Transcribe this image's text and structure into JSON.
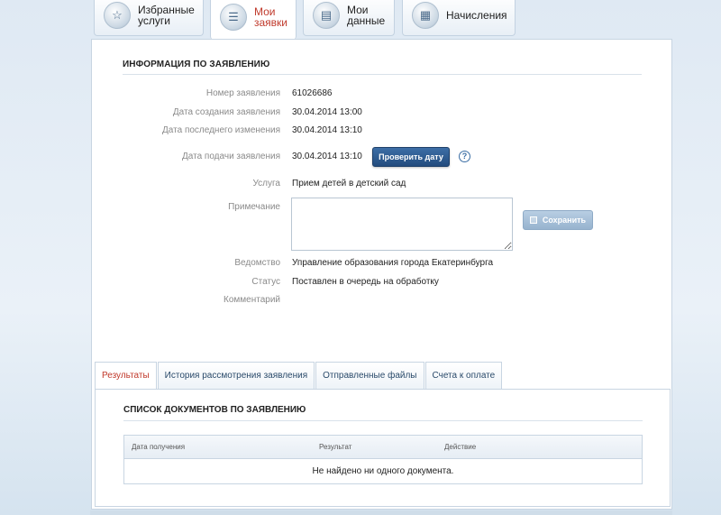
{
  "top_tabs": [
    {
      "label": "Избранные\nуслуги",
      "icon": "favorites-icon"
    },
    {
      "label": "Мои\nзаявки",
      "icon": "applications-icon"
    },
    {
      "label": "Мои\nданные",
      "icon": "my-data-icon"
    },
    {
      "label": "Начисления",
      "icon": "charges-icon"
    }
  ],
  "info": {
    "title": "ИНФОРМАЦИЯ ПО ЗАЯВЛЕНИЮ",
    "fields": {
      "number": {
        "label": "Номер заявления",
        "value": "61026686"
      },
      "created": {
        "label": "Дата создания заявления",
        "value": "30.04.2014 13:00"
      },
      "modified": {
        "label": "Дата последнего изменения",
        "value": "30.04.2014 13:10"
      },
      "submitted": {
        "label": "Дата подачи заявления",
        "value": "30.04.2014 13:10"
      },
      "service": {
        "label": "Услуга",
        "value": "Прием детей в детский сад"
      },
      "note": {
        "label": "Примечание",
        "value": ""
      },
      "agency": {
        "label": "Ведомство",
        "value": "Управление образования города Екатеринбурга"
      },
      "status": {
        "label": "Статус",
        "value": "Поставлен в очередь на обработку"
      },
      "comment": {
        "label": "Комментарий",
        "value": ""
      }
    },
    "check_date_button": "Проверить дату",
    "help_symbol": "?",
    "save_button": "Сохранить"
  },
  "bottom_tabs": [
    "Результаты",
    "История рассмотрения заявления",
    "Отправленные файлы",
    "Счета к оплате"
  ],
  "documents": {
    "title": "СПИСОК ДОКУМЕНТОВ ПО ЗАЯВЛЕНИЮ",
    "columns": [
      "Дата получения",
      "Результат",
      "Действие"
    ],
    "empty_text": "Не найдено ни одного документа."
  },
  "colors": {
    "accent_red": "#c0392b",
    "primary_button": "#2c5a8f",
    "disabled_button": "#a8c1da"
  }
}
